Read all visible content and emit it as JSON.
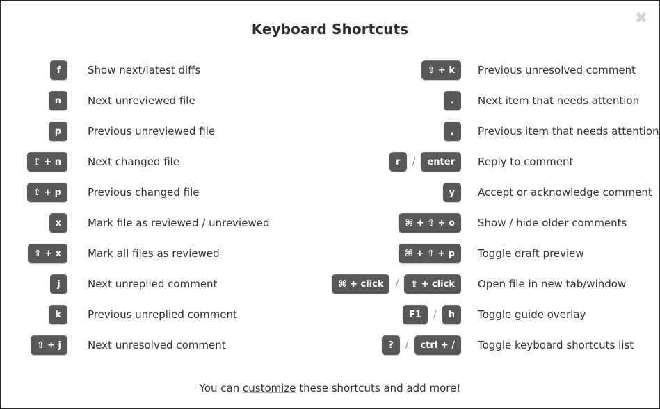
{
  "dialog": {
    "title": "Keyboard Shortcuts",
    "close_icon": "✖",
    "separator": "/",
    "accent_key_bg": "#585858",
    "key_text_color": "#ffffff",
    "label_color": "#303030",
    "close_icon_color": "#d4d4d4"
  },
  "footer": {
    "before": "You can ",
    "link": "customize",
    "after": " these shortcuts and add more!"
  },
  "left_column": [
    {
      "keys": [
        "f"
      ],
      "label": "Show next/latest diffs"
    },
    {
      "keys": [
        "n"
      ],
      "label": "Next unreviewed file"
    },
    {
      "keys": [
        "p"
      ],
      "label": "Previous unreviewed file"
    },
    {
      "keys": [
        "⇧ + n"
      ],
      "label": "Next changed file"
    },
    {
      "keys": [
        "⇧ + p"
      ],
      "label": "Previous changed file"
    },
    {
      "keys": [
        "x"
      ],
      "label": "Mark file as reviewed / unreviewed"
    },
    {
      "keys": [
        "⇧ + x"
      ],
      "label": "Mark all files as reviewed"
    },
    {
      "keys": [
        "j"
      ],
      "label": "Next unreplied comment"
    },
    {
      "keys": [
        "k"
      ],
      "label": "Previous unreplied comment"
    },
    {
      "keys": [
        "⇧ + j"
      ],
      "label": "Next unresolved comment"
    }
  ],
  "right_column": [
    {
      "keys": [
        "⇧ + k"
      ],
      "label": "Previous unresolved comment"
    },
    {
      "keys": [
        "."
      ],
      "label": "Next item that needs attention"
    },
    {
      "keys": [
        ","
      ],
      "label": "Previous item that needs attention"
    },
    {
      "keys": [
        "r",
        "enter"
      ],
      "label": "Reply to comment"
    },
    {
      "keys": [
        "y"
      ],
      "label": "Accept or acknowledge comment"
    },
    {
      "keys": [
        "⌘ + ⇧ + o"
      ],
      "label": "Show / hide older comments"
    },
    {
      "keys": [
        "⌘ + ⇧ + p"
      ],
      "label": "Toggle draft preview"
    },
    {
      "keys": [
        "⌘ + click",
        "⇧ + click"
      ],
      "label": "Open file in new tab/window"
    },
    {
      "keys": [
        "F1",
        "h"
      ],
      "label": "Toggle guide overlay"
    },
    {
      "keys": [
        "?",
        "ctrl + /"
      ],
      "label": "Toggle keyboard shortcuts list"
    }
  ]
}
